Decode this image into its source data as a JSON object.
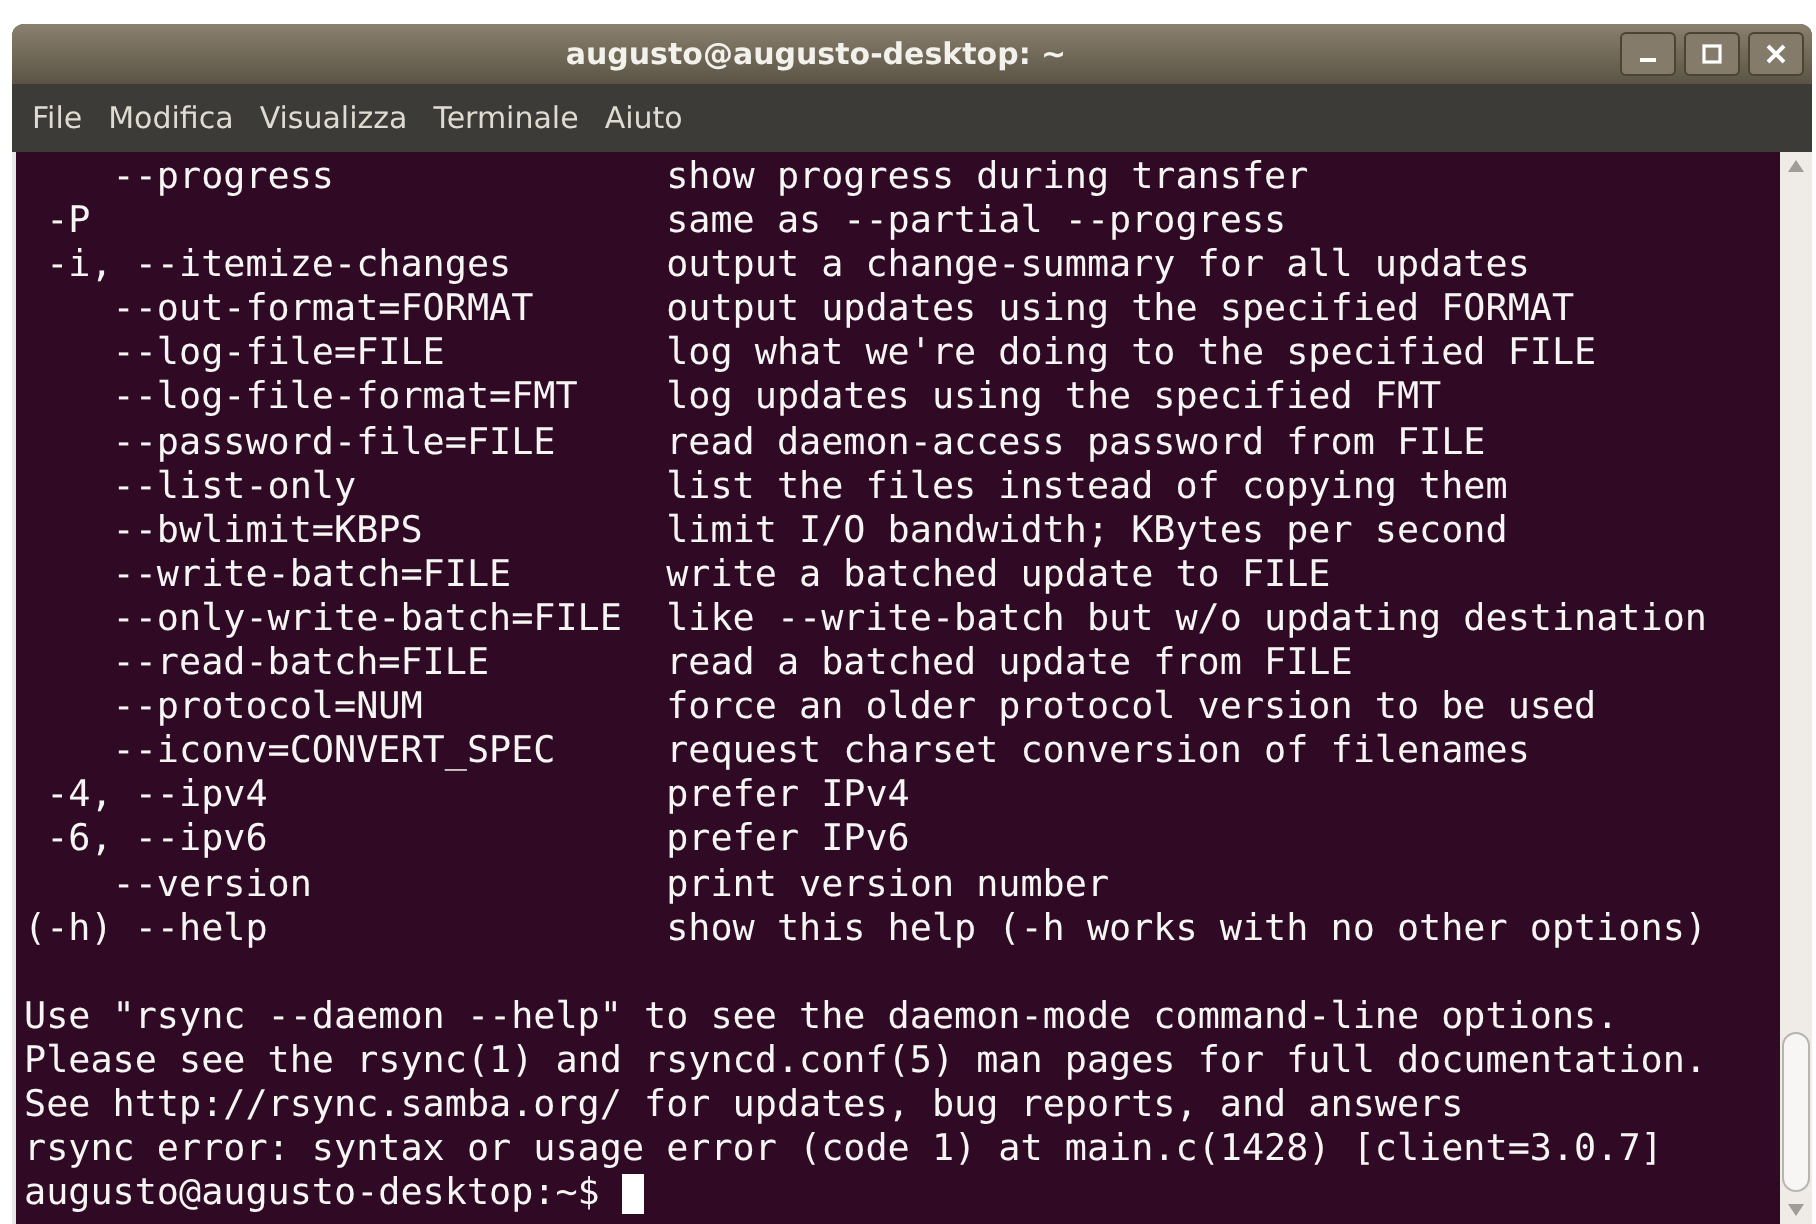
{
  "window": {
    "title": "augusto@augusto-desktop: ~"
  },
  "menu": [
    "File",
    "Modifica",
    "Visualizza",
    "Terminale",
    "Aiuto"
  ],
  "terminal": {
    "lines": [
      {
        "kind": "option",
        "option": "    --progress",
        "description": "show progress during transfer"
      },
      {
        "kind": "option",
        "option": " -P",
        "description": "same as --partial --progress"
      },
      {
        "kind": "option",
        "option": " -i, --itemize-changes",
        "description": "output a change-summary for all updates"
      },
      {
        "kind": "option",
        "option": "    --out-format=FORMAT",
        "description": "output updates using the specified FORMAT"
      },
      {
        "kind": "option",
        "option": "    --log-file=FILE",
        "description": "log what we're doing to the specified FILE"
      },
      {
        "kind": "option",
        "option": "    --log-file-format=FMT",
        "description": "log updates using the specified FMT"
      },
      {
        "kind": "option",
        "option": "    --password-file=FILE",
        "description": "read daemon-access password from FILE"
      },
      {
        "kind": "option",
        "option": "    --list-only",
        "description": "list the files instead of copying them"
      },
      {
        "kind": "option",
        "option": "    --bwlimit=KBPS",
        "description": "limit I/O bandwidth; KBytes per second"
      },
      {
        "kind": "option",
        "option": "    --write-batch=FILE",
        "description": "write a batched update to FILE"
      },
      {
        "kind": "option",
        "option": "    --only-write-batch=FILE",
        "description": "like --write-batch but w/o updating destination"
      },
      {
        "kind": "option",
        "option": "    --read-batch=FILE",
        "description": "read a batched update from FILE"
      },
      {
        "kind": "option",
        "option": "    --protocol=NUM",
        "description": "force an older protocol version to be used"
      },
      {
        "kind": "option",
        "option": "    --iconv=CONVERT_SPEC",
        "description": "request charset conversion of filenames"
      },
      {
        "kind": "option",
        "option": " -4, --ipv4",
        "description": "prefer IPv4"
      },
      {
        "kind": "option",
        "option": " -6, --ipv6",
        "description": "prefer IPv6"
      },
      {
        "kind": "option",
        "option": "    --version",
        "description": "print version number"
      },
      {
        "kind": "option",
        "option": "(-h) --help",
        "description": "show this help (-h works with no other options)"
      },
      {
        "kind": "blank"
      },
      {
        "kind": "text",
        "text": "Use \"rsync --daemon --help\" to see the daemon-mode command-line options."
      },
      {
        "kind": "text",
        "text": "Please see the rsync(1) and rsyncd.conf(5) man pages for full documentation."
      },
      {
        "kind": "text",
        "text": "See http://rsync.samba.org/ for updates, bug reports, and answers"
      },
      {
        "kind": "text",
        "text": "rsync error: syntax or usage error (code 1) at main.c(1428) [client=3.0.7]"
      },
      {
        "kind": "prompt",
        "text": "augusto@augusto-desktop:~$"
      }
    ]
  }
}
